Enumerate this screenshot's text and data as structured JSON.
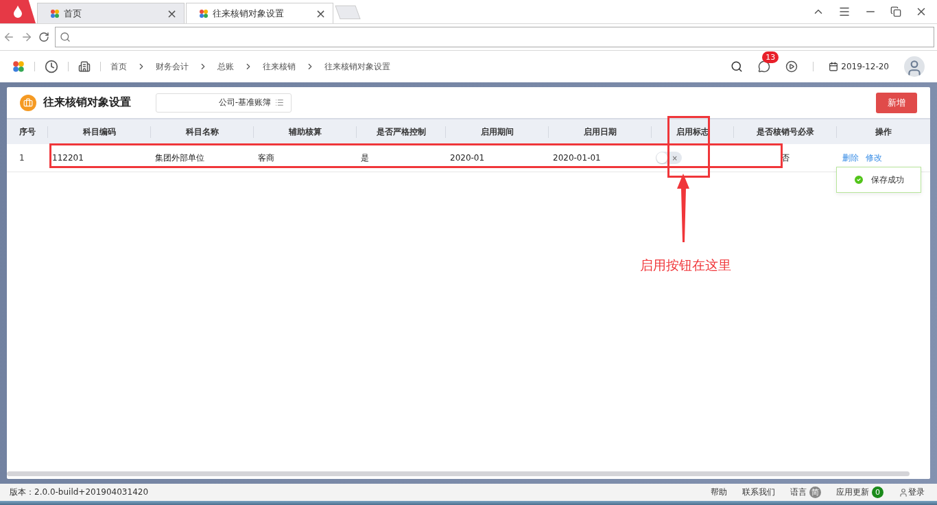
{
  "browser": {
    "tabs": [
      {
        "label": "首页",
        "selected": false
      },
      {
        "label": "往来核销对象设置",
        "selected": true
      }
    ],
    "close_glyph": "×"
  },
  "header": {
    "breadcrumb": [
      "首页",
      "财务会计",
      "总账",
      "往来核销",
      "往来核销对象设置"
    ],
    "notification_count": "13",
    "date": "2019-12-20"
  },
  "page": {
    "title": "往来核销对象设置",
    "ledger": "公司-基准账簿",
    "add_button": "新增"
  },
  "table": {
    "columns": [
      "序号",
      "科目编码",
      "科目名称",
      "辅助核算",
      "是否严格控制",
      "启用期间",
      "启用日期",
      "启用标志",
      "是否核销号必录",
      "操作"
    ],
    "rows": [
      {
        "cells": [
          "1",
          "112201",
          "集团外部单位",
          "客商",
          "是",
          "2020-01",
          "2020-01-01"
        ],
        "enabled": false,
        "toggle_glyph": "×",
        "required": "否",
        "actions": [
          "删除",
          "修改"
        ]
      }
    ]
  },
  "toast": {
    "text": "保存成功"
  },
  "annotation": {
    "text": "启用按钮在这里"
  },
  "status_bar": {
    "version": "版本：2.0.0-build+201904031420",
    "links": [
      "帮助",
      "联系我们",
      "语言"
    ],
    "language_badge": "简",
    "updates": "应用更新",
    "update_count": "0",
    "login": "登录"
  }
}
